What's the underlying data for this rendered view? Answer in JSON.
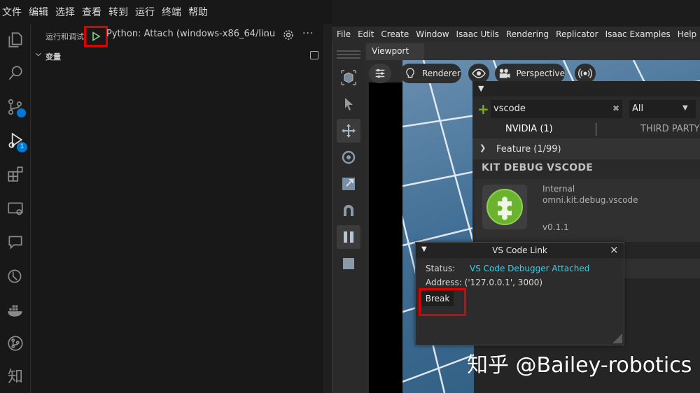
{
  "vscode": {
    "menu": [
      "文件",
      "编辑",
      "选择",
      "查看",
      "转到",
      "运行",
      "终端",
      "帮助"
    ],
    "activity_icons": [
      "explorer-icon",
      "search-icon",
      "source-control-icon",
      "run-debug-icon",
      "extensions-icon",
      "remote-explorer-icon",
      "comments-icon",
      "testing-icon",
      "docker-icon",
      "git-graph-icon",
      "zhihu-icon"
    ],
    "activity_badge": "1",
    "zhihu_glyph": "知",
    "run": {
      "title": "运行和调试",
      "config": "Python: Attach (windows-x86_64/linu",
      "chevron": "⌵",
      "more": "···"
    },
    "variables_label": "变量"
  },
  "isaac": {
    "menu": [
      "File",
      "Edit",
      "Create",
      "Window",
      "Isaac Utils",
      "Rendering",
      "Replicator",
      "Isaac Examples",
      "Help"
    ],
    "viewport_tab": "Viewport",
    "viewport_toolbar": {
      "renderer": "Renderer",
      "camera": "Perspective"
    },
    "extensions": {
      "search_value": "vscode",
      "filter_value": "All",
      "tabs": [
        "NVIDIA (1)",
        "THIRD PARTY"
      ],
      "section": "Feature (1/99)",
      "ext_title": "KIT DEBUG VSCODE",
      "category": "Internal",
      "ext_id": "omni.kit.debug.vscode",
      "version": "v0.1.1"
    },
    "dialog": {
      "title": "VS Code Link",
      "status_label": "Status:",
      "status_value": "VS Code Debugger Attached",
      "address": "Address: ('127.0.0.1', 3000)",
      "break_label": "Break",
      "close": "×"
    }
  },
  "colors": {
    "highlight_red": "#e00000",
    "status_cyan": "#2fd3f0",
    "nvidia_green": "#76b900",
    "vscode_blue": "#0078d4"
  },
  "watermark": "知乎 @Bailey-robotics"
}
